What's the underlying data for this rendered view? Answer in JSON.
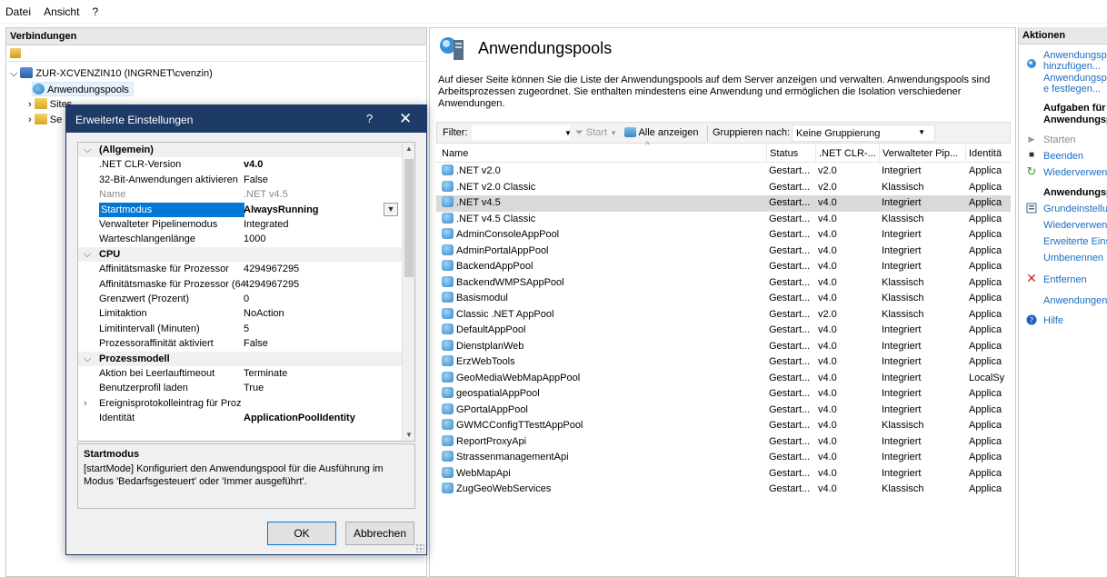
{
  "menu": [
    "Datei",
    "Ansicht",
    "?"
  ],
  "left": {
    "title": "Verbindungen",
    "tree": {
      "server": "ZUR-XCVENZIN10 (INGRNET\\cvenzin)",
      "pools": "Anwendungspools",
      "sites": "Sites",
      "third": "Se"
    }
  },
  "center": {
    "title": "Anwendungspools",
    "description": "Auf dieser Seite können Sie die Liste der Anwendungspools auf dem Server anzeigen und verwalten. Anwendungspools sind Arbeitsprozessen zugeordnet. Sie enthalten mindestens eine Anwendung und ermöglichen die Isolation verschiedener Anwendungen.",
    "filter": {
      "label": "Filter:",
      "start": "Start",
      "show_all": "Alle anzeigen",
      "group_by": "Gruppieren nach:",
      "group_value": "Keine Gruppierung"
    },
    "columns": [
      "Name",
      "Status",
      ".NET CLR-...",
      "Verwalteter Pip...",
      "Identitä"
    ],
    "rows": [
      {
        "name": ".NET v2.0",
        "status": "Gestart...",
        "clr": "v2.0",
        "pipe": "Integriert",
        "id": "Applica"
      },
      {
        "name": ".NET v2.0 Classic",
        "status": "Gestart...",
        "clr": "v2.0",
        "pipe": "Klassisch",
        "id": "Applica"
      },
      {
        "name": ".NET v4.5",
        "status": "Gestart...",
        "clr": "v4.0",
        "pipe": "Integriert",
        "id": "Applica"
      },
      {
        "name": ".NET v4.5 Classic",
        "status": "Gestart...",
        "clr": "v4.0",
        "pipe": "Klassisch",
        "id": "Applica"
      },
      {
        "name": "AdminConsoleAppPool",
        "status": "Gestart...",
        "clr": "v4.0",
        "pipe": "Integriert",
        "id": "Applica"
      },
      {
        "name": "AdminPortalAppPool",
        "status": "Gestart...",
        "clr": "v4.0",
        "pipe": "Integriert",
        "id": "Applica"
      },
      {
        "name": "BackendAppPool",
        "status": "Gestart...",
        "clr": "v4.0",
        "pipe": "Integriert",
        "id": "Applica"
      },
      {
        "name": "BackendWMPSAppPool",
        "status": "Gestart...",
        "clr": "v4.0",
        "pipe": "Klassisch",
        "id": "Applica"
      },
      {
        "name": "Basismodul",
        "status": "Gestart...",
        "clr": "v4.0",
        "pipe": "Klassisch",
        "id": "Applica"
      },
      {
        "name": "Classic .NET AppPool",
        "status": "Gestart...",
        "clr": "v2.0",
        "pipe": "Klassisch",
        "id": "Applica"
      },
      {
        "name": "DefaultAppPool",
        "status": "Gestart...",
        "clr": "v4.0",
        "pipe": "Integriert",
        "id": "Applica"
      },
      {
        "name": "DienstplanWeb",
        "status": "Gestart...",
        "clr": "v4.0",
        "pipe": "Integriert",
        "id": "Applica"
      },
      {
        "name": "ErzWebTools",
        "status": "Gestart...",
        "clr": "v4.0",
        "pipe": "Integriert",
        "id": "Applica"
      },
      {
        "name": "GeoMediaWebMapAppPool",
        "status": "Gestart...",
        "clr": "v4.0",
        "pipe": "Integriert",
        "id": "LocalSy"
      },
      {
        "name": "geospatialAppPool",
        "status": "Gestart...",
        "clr": "v4.0",
        "pipe": "Integriert",
        "id": "Applica"
      },
      {
        "name": "GPortalAppPool",
        "status": "Gestart...",
        "clr": "v4.0",
        "pipe": "Integriert",
        "id": "Applica"
      },
      {
        "name": "GWMCConfigTTesttAppPool",
        "status": "Gestart...",
        "clr": "v4.0",
        "pipe": "Klassisch",
        "id": "Applica"
      },
      {
        "name": "ReportProxyApi",
        "status": "Gestart...",
        "clr": "v4.0",
        "pipe": "Integriert",
        "id": "Applica"
      },
      {
        "name": "StrassenmanagementApi",
        "status": "Gestart...",
        "clr": "v4.0",
        "pipe": "Integriert",
        "id": "Applica"
      },
      {
        "name": "WebMapApi",
        "status": "Gestart...",
        "clr": "v4.0",
        "pipe": "Integriert",
        "id": "Applica"
      },
      {
        "name": "ZugGeoWebServices",
        "status": "Gestart...",
        "clr": "v4.0",
        "pipe": "Klassisch",
        "id": "Applica"
      }
    ],
    "selected_row": ".NET v4.5"
  },
  "actions": {
    "title": "Aktionen",
    "add_line1": "Anwendungsp",
    "add_line2": "hinzufügen...",
    "defaults_line1": "Anwendungsp",
    "defaults_line2": "e festlegen...",
    "tasks_line1": "Aufgaben für",
    "tasks_line2": "Anwendungsp",
    "start": "Starten",
    "stop": "Beenden",
    "recycle": "Wiederverwend",
    "section2": "Anwendungsp",
    "basic": "Grundeinstellu",
    "recycling": "Wiederverwend",
    "advanced": "Erweiterte Einst",
    "rename": "Umbenennen",
    "remove": "Entfernen",
    "apps": "Anwendungen",
    "help": "Hilfe"
  },
  "dialog": {
    "title": "Erweiterte Einstellungen",
    "help": "?",
    "close": "✕",
    "properties": [
      {
        "type": "cat",
        "key": "(Allgemein)"
      },
      {
        "key": ".NET CLR-Version",
        "value": "v4.0",
        "bold": true
      },
      {
        "key": "32-Bit-Anwendungen aktivieren",
        "value": "False"
      },
      {
        "key": "Name",
        "value": ".NET v4.5",
        "dim": true
      },
      {
        "key": "Startmodus",
        "value": "AlwaysRunning",
        "bold": true,
        "selected": true
      },
      {
        "key": "Verwalteter Pipelinemodus",
        "value": "Integrated"
      },
      {
        "key": "Warteschlangenlänge",
        "value": "1000"
      },
      {
        "type": "cat",
        "key": "CPU"
      },
      {
        "key": "Affinitätsmaske für Prozessor",
        "value": "4294967295"
      },
      {
        "key": "Affinitätsmaske für Prozessor (64",
        "value": "4294967295"
      },
      {
        "key": "Grenzwert (Prozent)",
        "value": "0"
      },
      {
        "key": "Limitaktion",
        "value": "NoAction"
      },
      {
        "key": "Limitintervall (Minuten)",
        "value": "5"
      },
      {
        "key": "Prozessoraffinität aktiviert",
        "value": "False"
      },
      {
        "type": "cat",
        "key": "Prozessmodell"
      },
      {
        "key": "Aktion bei Leerlauftimeout",
        "value": "Terminate"
      },
      {
        "key": "Benutzerprofil laden",
        "value": "True"
      },
      {
        "key": "Ereignisprotokolleintrag für Proz",
        "value": "",
        "collapsed": true
      },
      {
        "key": "Identität",
        "value": "ApplicationPoolIdentity",
        "bold": true
      }
    ],
    "desc_title": "Startmodus",
    "desc_text": "[startMode] Konfiguriert den Anwendungspool für die Ausführung im Modus 'Bedarfsgesteuert' oder 'Immer ausgeführt'.",
    "ok": "OK",
    "cancel": "Abbrechen"
  }
}
